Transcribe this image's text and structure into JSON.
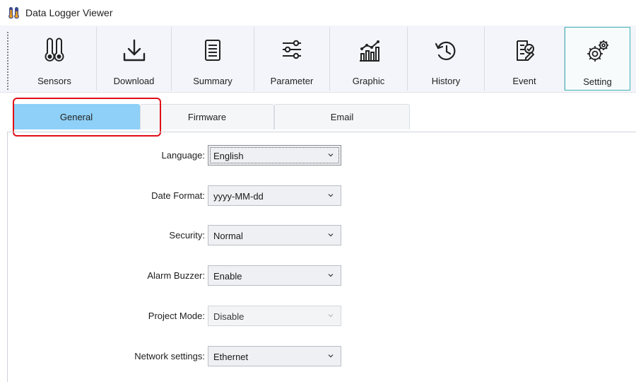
{
  "window": {
    "title": "Data Logger Viewer",
    "app_icon": "thermometer-icon"
  },
  "toolbar": {
    "items": [
      {
        "label": "Sensors",
        "icon": "thermometers-icon"
      },
      {
        "label": "Download",
        "icon": "download-icon"
      },
      {
        "label": "Summary",
        "icon": "summary-list-icon"
      },
      {
        "label": "Parameter",
        "icon": "sliders-icon"
      },
      {
        "label": "Graphic",
        "icon": "chart-icon"
      },
      {
        "label": "History",
        "icon": "history-icon"
      },
      {
        "label": "Event",
        "icon": "event-check-icon"
      },
      {
        "label": "Setting",
        "icon": "gears-icon",
        "active": true
      }
    ]
  },
  "tabs": [
    {
      "label": "General",
      "selected": true
    },
    {
      "label": "Firmware"
    },
    {
      "label": "Email"
    }
  ],
  "form": {
    "fields": [
      {
        "label": "Language:",
        "value": "English",
        "focused": true
      },
      {
        "label": "Date Format:",
        "value": "yyyy-MM-dd"
      },
      {
        "label": "Security:",
        "value": "Normal"
      },
      {
        "label": "Alarm Buzzer:",
        "value": "Enable"
      },
      {
        "label": "Project Mode:",
        "value": "Disable",
        "disabled": true
      },
      {
        "label": "Network settings:",
        "value": "Ethernet"
      }
    ]
  },
  "colors": {
    "tab_selected": "#8ed0f7",
    "highlight_outline": "#e10d17",
    "active_tool_border": "#3fb2b9",
    "toolbar_bg": "#f3f5fa"
  }
}
